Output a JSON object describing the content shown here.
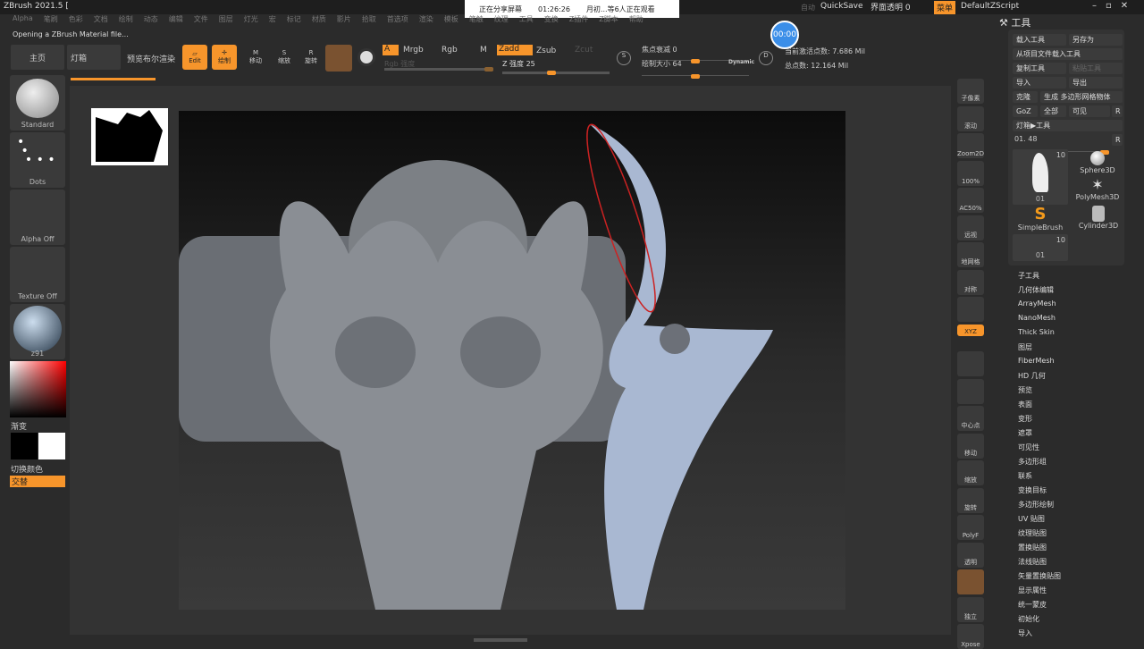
{
  "title": "ZBrush 2021.5 [",
  "share": {
    "status": "正在分享屏幕",
    "time": "01:26:26",
    "viewers": "月初...等6人正在观看"
  },
  "menu": [
    "Alpha",
    "笔刷",
    "色彩",
    "文档",
    "绘制",
    "动态",
    "编辑",
    "文件",
    "图层",
    "灯光",
    "宏",
    "标记",
    "材质",
    "影片",
    "拾取",
    "首选项",
    "渲染",
    "模板",
    "笔触",
    "纹理",
    "工具",
    "变换",
    "Z插件",
    "Z脚本",
    "帮助"
  ],
  "topright": {
    "autosave": "自动",
    "quicksave": "QuickSave",
    "transparency": "界面透明 0",
    "menus": "菜单",
    "script": "DefaultZScript"
  },
  "status": "Opening a ZBrush Material file...",
  "tabs": [
    "主页",
    "灯箱",
    "预览布尔渲染"
  ],
  "toolbar": {
    "edit": "Edit",
    "draw": "绘制",
    "move": "移动",
    "scale": "缩放",
    "rotate": "旋转",
    "a": "A",
    "mrgb": "Mrgb",
    "rgb": "Rgb",
    "m": "M",
    "zadd": "Zadd",
    "zsub": "Zsub",
    "zcut": "Zcut",
    "rgb_intensity": "Rgb 强度",
    "z_intensity": "Z 强度 25",
    "focal": "焦点衰减 0",
    "draw_size": "绘制大小 64",
    "dynamic": "Dynamic",
    "active_points": "当前激活点数: 7.686 Mil",
    "total_points": "总点数: 12.164 Mil",
    "timer": "00:00"
  },
  "left": {
    "brush": "Standard",
    "stroke": "Dots",
    "alpha": "Alpha Off",
    "texture": "Texture Off",
    "material": "z91",
    "gradient": "渐变",
    "switch": "切换颜色",
    "alternate": "交替"
  },
  "shelf": [
    "子像素",
    "滚动",
    "Zoom2D",
    "100%",
    "AC50%",
    "远视",
    "地网格",
    "对称",
    "",
    "XYZ",
    "",
    "",
    "中心点",
    "移动",
    "缩放",
    "旋转",
    "PolyF",
    "透明",
    "",
    "独立",
    "Xpose"
  ],
  "tool": {
    "title": "工具",
    "buttons": [
      "载入工具",
      "另存为",
      "从项目文件载入工具",
      "复制工具",
      "粘贴工具",
      "导入",
      "导出",
      "克隆",
      "生成 多边形网格物体",
      "GoZ",
      "全部",
      "可见",
      "R",
      "灯箱▶工具"
    ],
    "slider": "01. 48",
    "r": "R",
    "items": [
      {
        "name": "01",
        "count": "10"
      },
      {
        "name": "Sphere3D"
      },
      {
        "name": "PolyMesh3D"
      },
      {
        "name": "SimpleBrush"
      },
      {
        "name": "Cylinder3D"
      },
      {
        "name": "01",
        "count": "10"
      }
    ],
    "subpalettes": [
      "子工具",
      "几何体编辑",
      "ArrayMesh",
      "NanoMesh",
      "Thick Skin",
      "图层",
      "FiberMesh",
      "HD 几何",
      "预览",
      "表面",
      "变形",
      "遮罩",
      "可见性",
      "多边形组",
      "联系",
      "变换目标",
      "多边形绘制",
      "UV 贴图",
      "纹理贴图",
      "置换贴图",
      "法线贴图",
      "矢量置换贴图",
      "显示属性",
      "统一蒙皮",
      "初始化",
      "导入"
    ]
  }
}
